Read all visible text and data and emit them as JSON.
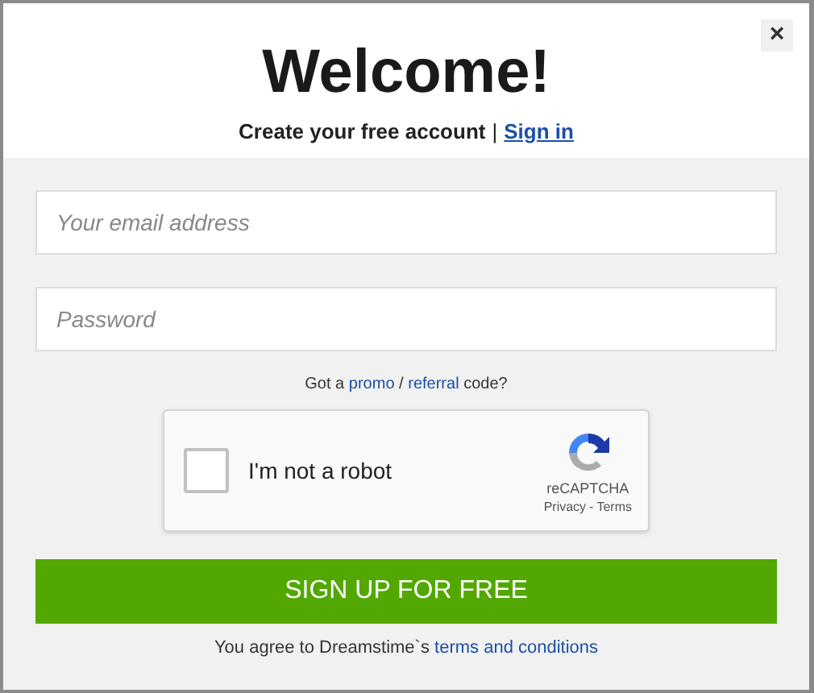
{
  "dialog": {
    "title": "Welcome!",
    "subtitle": "Create your free account",
    "separator": "|",
    "sign_in_link": "Sign in",
    "close": "×"
  },
  "fields": [
    {
      "placeholder": "Your email address"
    },
    {
      "placeholder": "Password"
    }
  ],
  "promo": {
    "before": "Got a",
    "promo_link": "promo",
    "slash": "/",
    "referral_link": "referral",
    "after": "code?"
  },
  "captcha": {
    "label": "I'm not a robot",
    "checked": false,
    "brand": "reCAPTCHA",
    "privacy": "Privacy",
    "dot": "-",
    "terms": "Terms"
  },
  "submit_button": "SIGN UP FOR FREE",
  "agreement": {
    "text": "You agree to Dreamstime`s",
    "link": "terms and conditions"
  }
}
